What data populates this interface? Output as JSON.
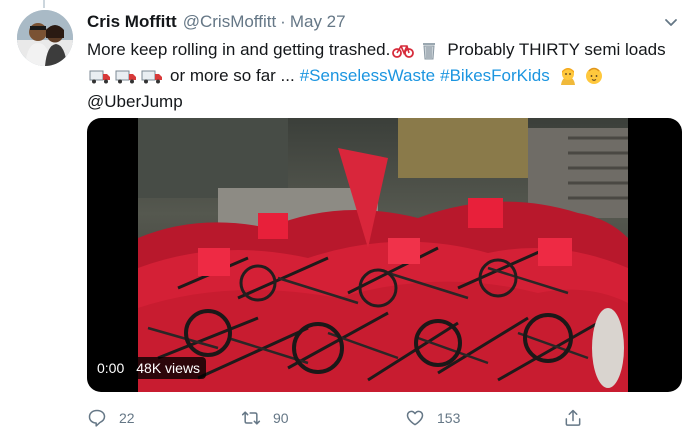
{
  "tweet": {
    "author_name": "Cris Moffitt",
    "handle": "@CrisMoffitt",
    "separator": "·",
    "date": "May 27",
    "text_line1": "More keep rolling in and getting trashed.",
    "text_line1b": "Probably THIRTY semi loads",
    "text_line2": "or more so far ...",
    "hashtag1": "#SenselessWaste",
    "hashtag2": "#BikesForKids",
    "mention": "@UberJump",
    "emoji_names": [
      "bicycle-emoji",
      "wastebasket-emoji",
      "truck-emoji",
      "person-emoji",
      "baby-emoji"
    ]
  },
  "media": {
    "duration": "0:00",
    "views": "48K views"
  },
  "actions": {
    "reply_count": "22",
    "retweet_count": "90",
    "like_count": "153"
  },
  "colors": {
    "link": "#1b95e0",
    "muted": "#657786",
    "bike_red": "#e8203a"
  }
}
